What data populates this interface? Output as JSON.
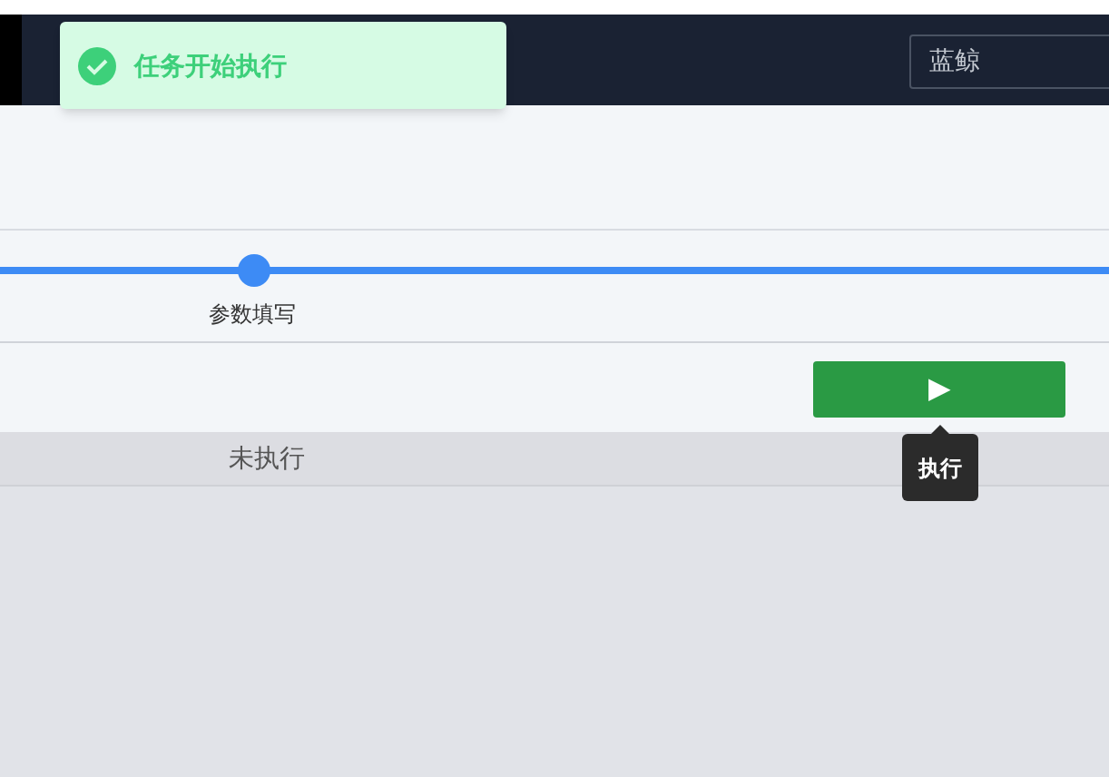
{
  "toast": {
    "message": "任务开始执行"
  },
  "header": {
    "field": {
      "value": "蓝鲸"
    }
  },
  "steps": [
    {
      "label": "参数填写"
    }
  ],
  "run_button": {
    "symbol": "▶",
    "tooltip": "执行"
  },
  "table": {
    "status": "未执行"
  }
}
